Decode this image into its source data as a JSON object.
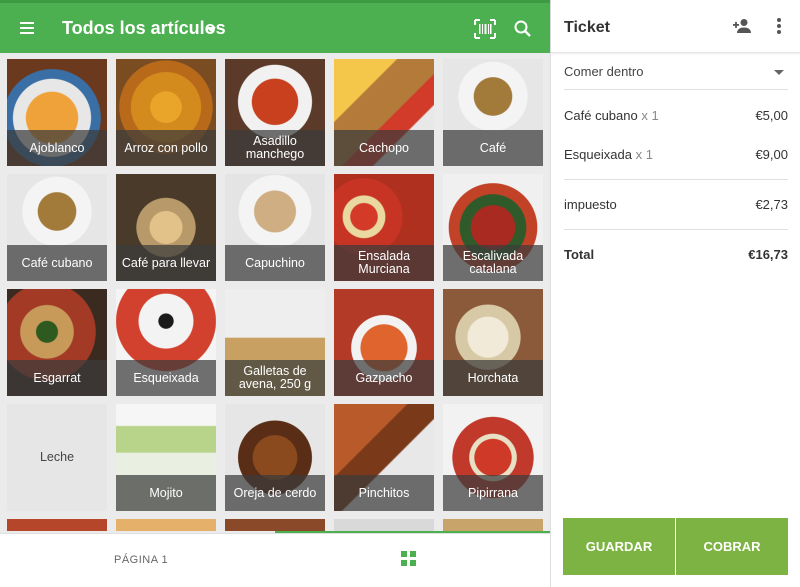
{
  "header": {
    "title": "Todos los artículos"
  },
  "items": [
    {
      "label": "Ajoblanco",
      "style": "soup"
    },
    {
      "label": "Arroz con pollo",
      "style": "paella"
    },
    {
      "label": "Asadillo manchego",
      "style": "redsauce"
    },
    {
      "label": "Cachopo",
      "style": "fries"
    },
    {
      "label": "Café",
      "style": "coffee"
    },
    {
      "label": "Café cubano",
      "style": "coffee"
    },
    {
      "label": "Café para llevar",
      "style": "cup"
    },
    {
      "label": "Capuchino",
      "style": "cappuccino"
    },
    {
      "label": "Ensalada Murciana",
      "style": "tomato"
    },
    {
      "label": "Escalivada catalana",
      "style": "pepper"
    },
    {
      "label": "Esgarrat",
      "style": "olives"
    },
    {
      "label": "Esqueixada",
      "style": "esqueixada"
    },
    {
      "label": "Galletas de avena, 250 g",
      "style": "cookies"
    },
    {
      "label": "Gazpacho",
      "style": "gazpacho"
    },
    {
      "label": "Horchata",
      "style": "horchata"
    },
    {
      "label": "Leche",
      "style": "plain"
    },
    {
      "label": "Mojito",
      "style": "mojito"
    },
    {
      "label": "Oreja de cerdo",
      "style": "meat"
    },
    {
      "label": "Pinchitos",
      "style": "skewer"
    },
    {
      "label": "Pipirrana",
      "style": "pipirrana"
    }
  ],
  "footer": {
    "page_label": "PÁGINA 1"
  },
  "ticket": {
    "title": "Ticket",
    "dining_option": "Comer dentro",
    "lines": [
      {
        "name": "Café cubano",
        "qty": "x 1",
        "price": "€5,00"
      },
      {
        "name": "Esqueixada",
        "qty": "x 1",
        "price": "€9,00"
      }
    ],
    "tax_label": "impuesto",
    "tax_value": "€2,73",
    "total_label": "Total",
    "total_value": "€16,73",
    "save_label": "GUARDAR",
    "charge_label": "COBRAR"
  },
  "colors": {
    "primary": "#4caf50",
    "button": "#7cb342"
  }
}
